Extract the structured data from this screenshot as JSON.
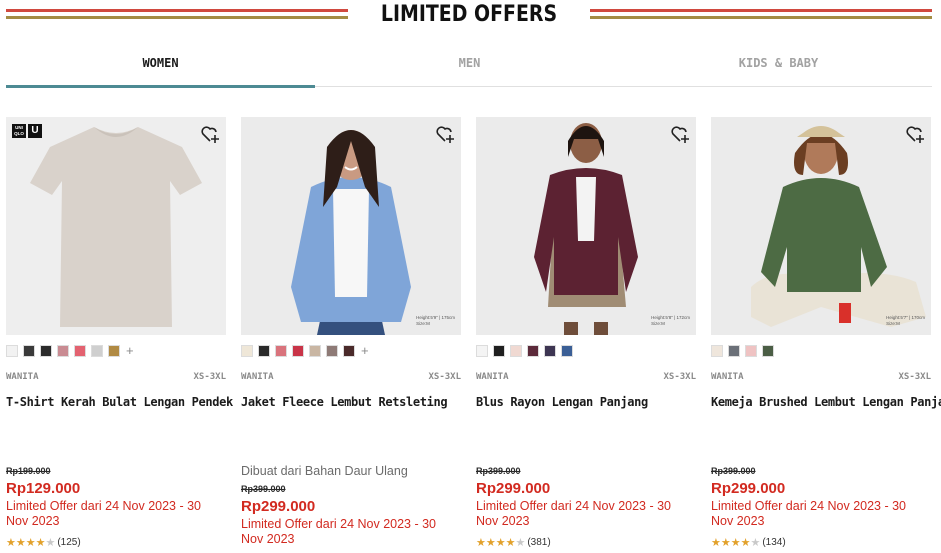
{
  "header": {
    "title": "LIMITED OFFERS"
  },
  "tabs": [
    {
      "label": "WOMEN",
      "active": true
    },
    {
      "label": "MEN",
      "active": false
    },
    {
      "label": "KIDS & BABY",
      "active": false
    }
  ],
  "products": [
    {
      "gender": "WANITA",
      "size": "XS-3XL",
      "name": "T-Shirt Kerah Bulat Lengan Pendek",
      "extra": "",
      "old_price": "Rp199.000",
      "price": "Rp129.000",
      "offer": "Limited Offer dari 24 Nov 2023 - 30 Nov 2023",
      "rating": 4.5,
      "reviews": "(125)",
      "colors": [
        "#f2f2f2",
        "#3a3a3a",
        "#2b2b2b",
        "#c98b92",
        "#e36270",
        "#cfcfcf",
        "#b08a43"
      ],
      "more_colors": true,
      "badge": {
        "line1": "UNI QLO",
        "line2": "U"
      },
      "model_note": ""
    },
    {
      "gender": "WANITA",
      "size": "XS-3XL",
      "name": "Jaket Fleece Lembut Retsleting",
      "extra": "Dibuat dari Bahan Daur Ulang",
      "old_price": "Rp399.000",
      "price": "Rp299.000",
      "offer": "Limited Offer dari 24 Nov 2023 - 30 Nov 2023",
      "rating": null,
      "reviews": "",
      "colors": [
        "#efe7d8",
        "#2a2a2a",
        "#d9737c",
        "#c93448",
        "#c9b6a3",
        "#8e7a76",
        "#4a2a2a"
      ],
      "more_colors": true,
      "model_note": "Height:5'9\" | 175cm\nSize:M"
    },
    {
      "gender": "WANITA",
      "size": "XS-3XL",
      "name": "Blus Rayon Lengan Panjang",
      "extra": "",
      "old_price": "Rp399.000",
      "price": "Rp299.000",
      "offer": "Limited Offer dari 24 Nov 2023 - 30 Nov 2023",
      "rating": 4.5,
      "reviews": "(381)",
      "colors": [
        "#f4f4f4",
        "#1f1f1f",
        "#f0d9d2",
        "#5c2a3a",
        "#3d3552",
        "#3b5f96"
      ],
      "more_colors": false,
      "model_note": "Height:5'8\" | 172cm\nSize:M"
    },
    {
      "gender": "WANITA",
      "size": "XS-3XL",
      "name": "Kemeja Brushed Lembut Lengan Panjang",
      "extra": "",
      "old_price": "Rp399.000",
      "price": "Rp299.000",
      "offer": "Limited Offer dari 24 Nov 2023 - 30 Nov 2023",
      "rating": 4.5,
      "reviews": "(134)",
      "colors": [
        "#efe6dc",
        "#6b7078",
        "#efc3c3",
        "#4b5e45"
      ],
      "more_colors": false,
      "model_note": "Height:5'7\" | 170cm\nSize:M"
    }
  ],
  "colors": {
    "accent_red": "#d22a20",
    "tab_underline": "#4d8a93",
    "stripe_red": "#d0493f",
    "stripe_gold": "#a38c44",
    "star": "#e2a12b"
  },
  "icons": {
    "favorite": "heart-plus-icon",
    "more_colors": "plus-icon",
    "star": "star-icon"
  }
}
